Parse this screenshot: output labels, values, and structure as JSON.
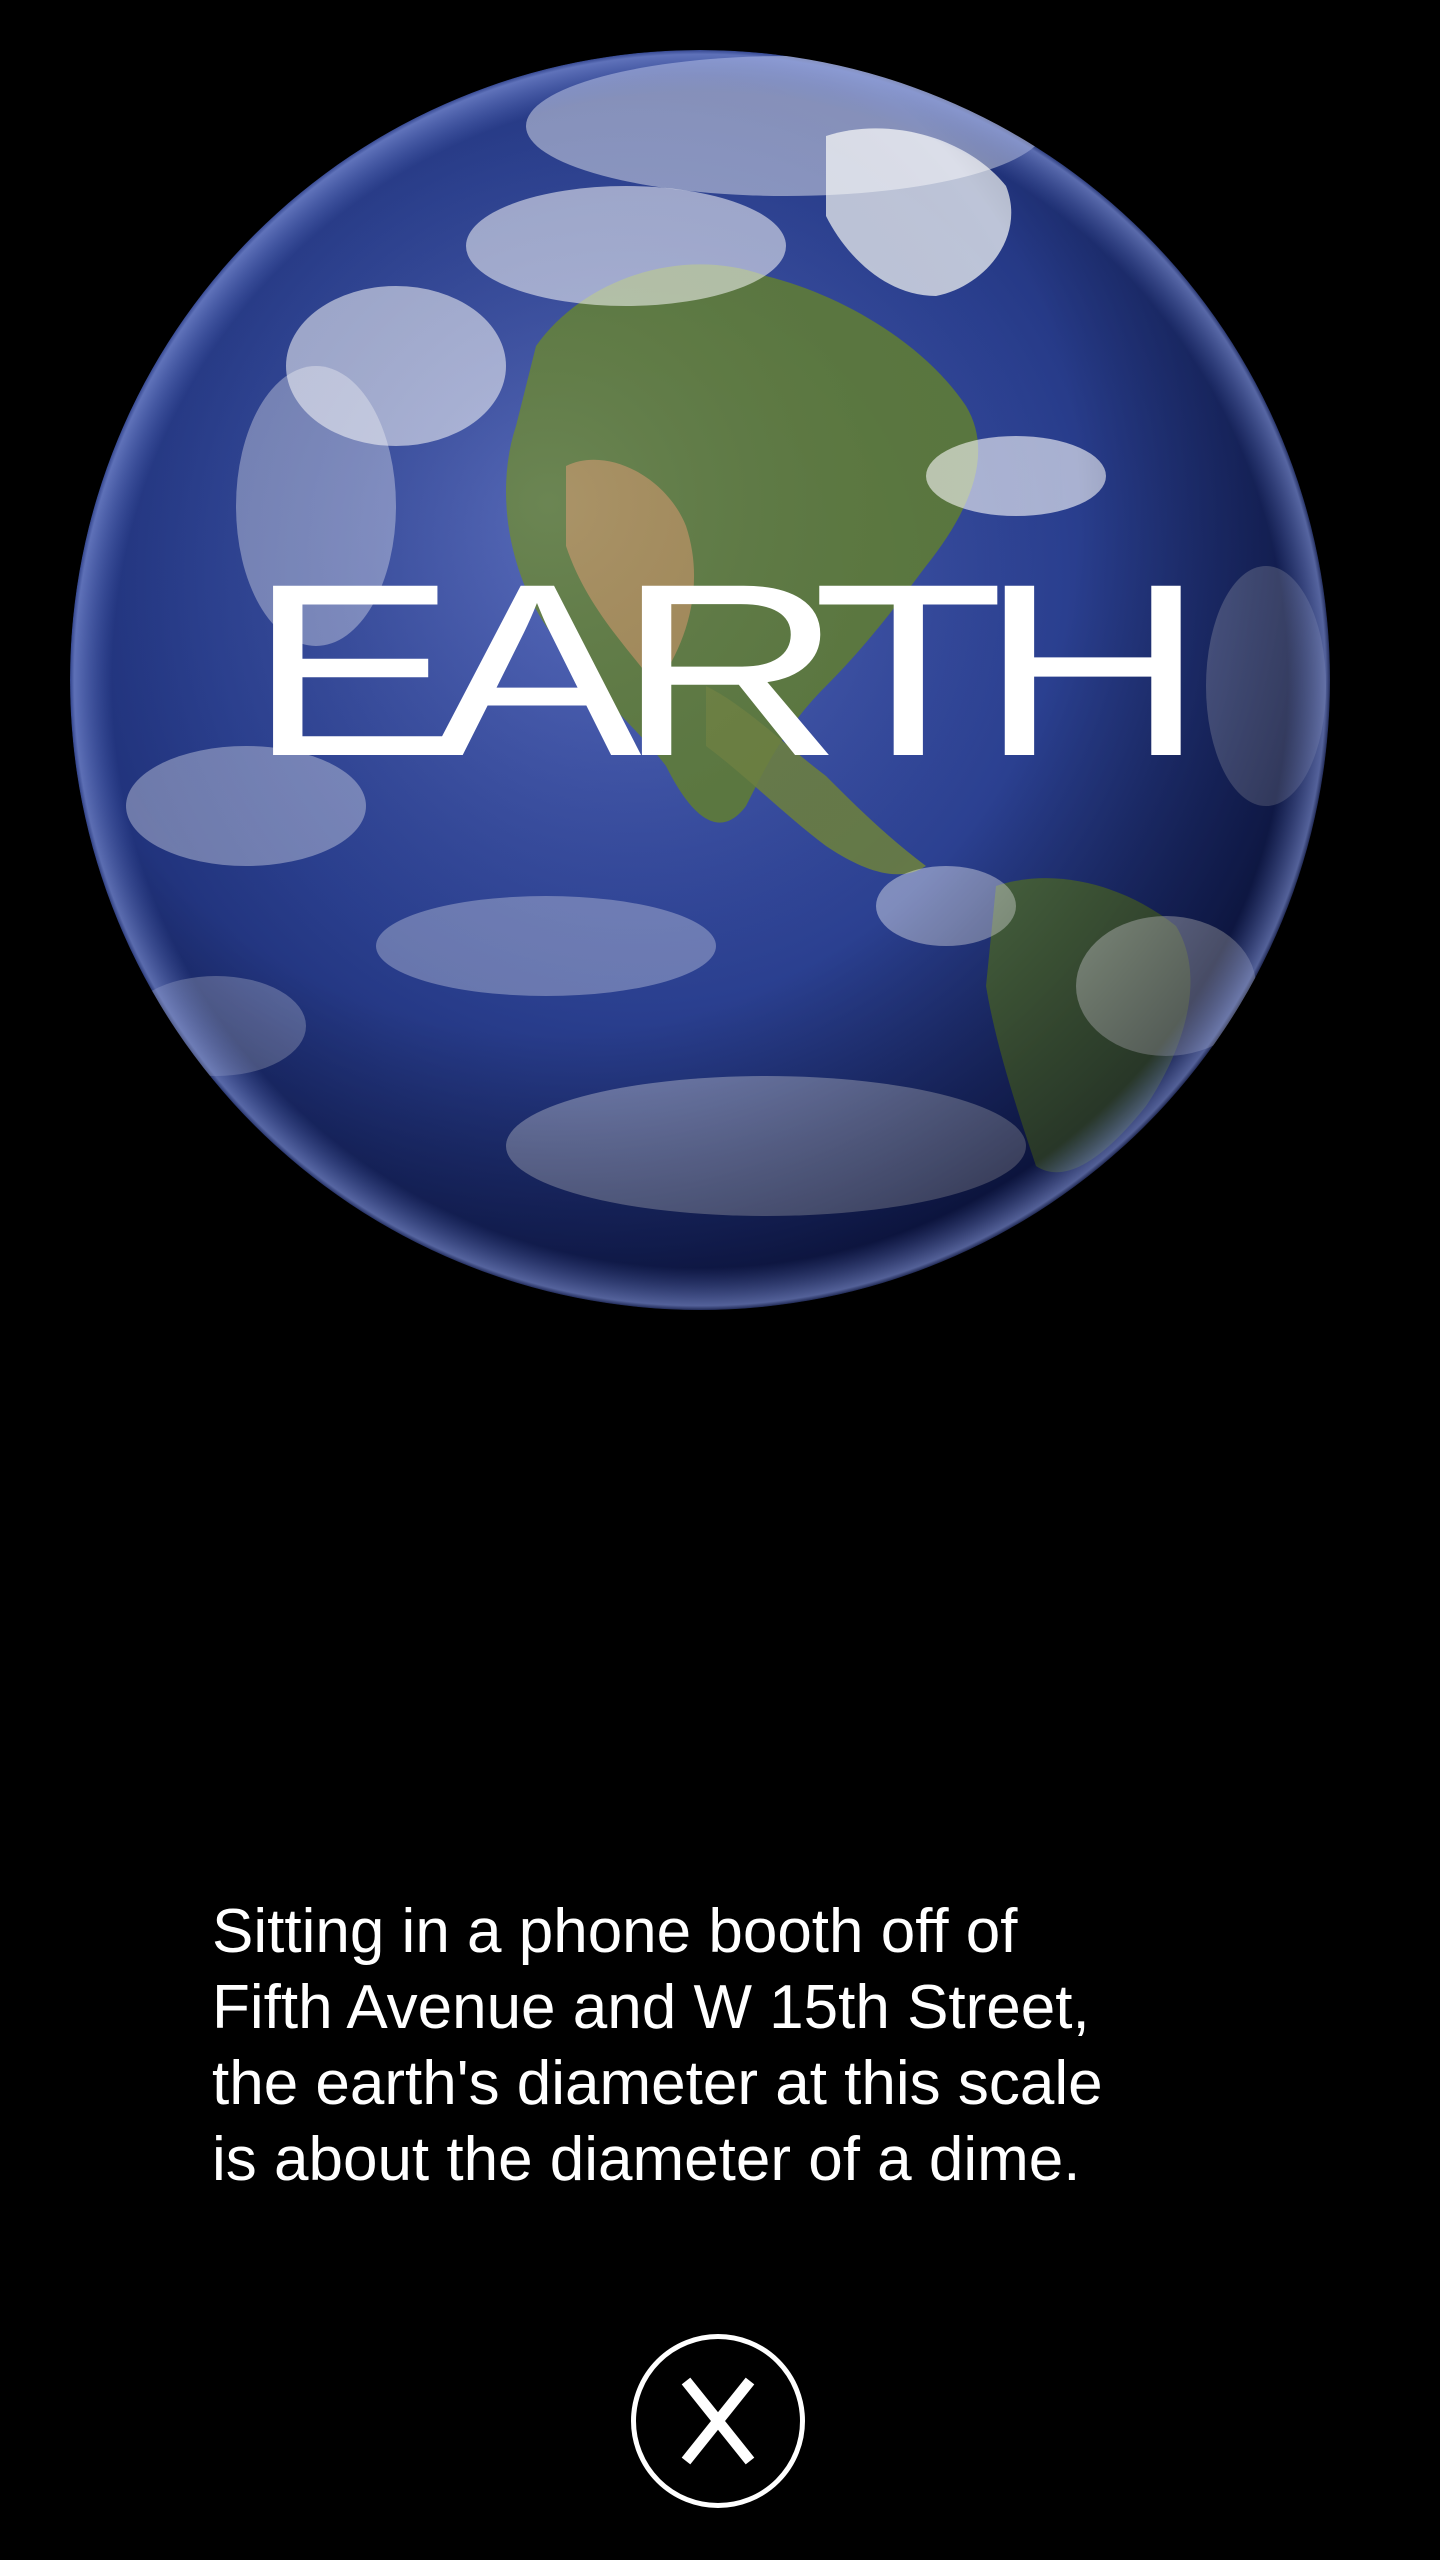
{
  "planet": {
    "title": "EARTH",
    "image_icon": "earth-globe-image",
    "colors": {
      "ocean": "#2a3f8f",
      "ocean_deep": "#0f1a52",
      "land_green": "#5d7a3a",
      "land_desert": "#a88a5a",
      "clouds": "#ffffff",
      "atmosphere": "#6f86d8"
    }
  },
  "description": {
    "lines": [
      "Sitting in a phone booth off of",
      "Fifth Avenue and W 15th Street,",
      "the earth's diameter at this scale",
      "is about the diameter of a dime."
    ]
  },
  "close_button": {
    "label": "X",
    "icon": "close-icon"
  },
  "theme": {
    "background": "#000000",
    "text": "#ffffff"
  }
}
